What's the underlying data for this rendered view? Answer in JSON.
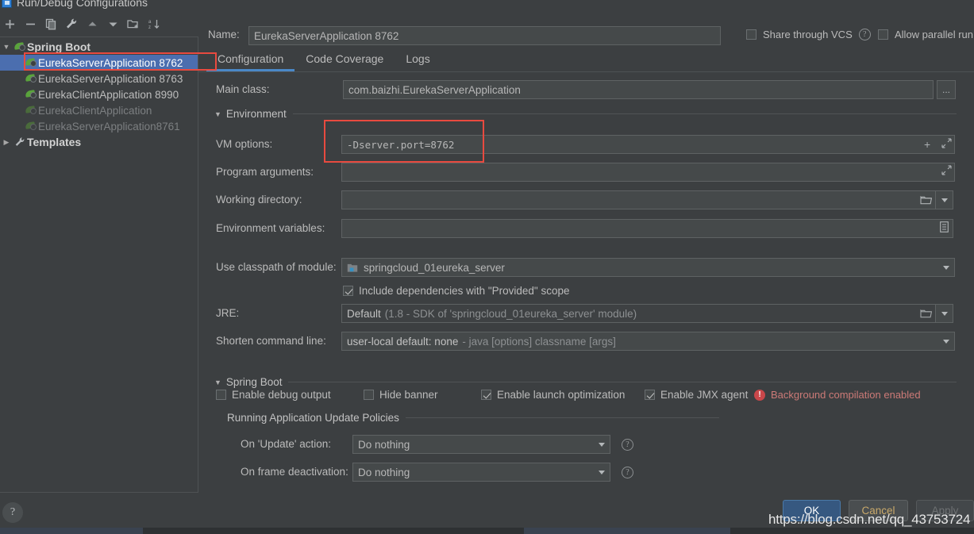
{
  "window": {
    "title": "Run/Debug Configurations",
    "icon": "idea-app-icon"
  },
  "toolbar": {
    "items": [
      {
        "name": "add-button",
        "icon": "plus-icon",
        "tooltip": "Add New Configuration"
      },
      {
        "name": "remove-button",
        "icon": "minus-icon",
        "tooltip": "Remove Configuration"
      },
      {
        "name": "copy-button",
        "icon": "copy-icon",
        "tooltip": "Copy Configuration"
      },
      {
        "name": "edit-templates-button",
        "icon": "wrench-icon",
        "tooltip": "Edit Templates"
      },
      {
        "name": "move-up-button",
        "icon": "arrow-up-icon",
        "tooltip": "Move Up"
      },
      {
        "name": "move-down-button",
        "icon": "arrow-down-icon",
        "tooltip": "Move Down"
      },
      {
        "name": "new-folder-button",
        "icon": "folder-add-icon",
        "tooltip": "Create New Folder"
      },
      {
        "name": "sort-button",
        "icon": "sort-alpha-icon",
        "tooltip": "Sort Configurations"
      }
    ]
  },
  "tree": {
    "group_label": "Spring Boot",
    "group_icon": "spring-boot-icon",
    "items": [
      {
        "label": "EurekaServerApplication 8762",
        "icon": "spring-boot-icon",
        "selected": true,
        "dim": false
      },
      {
        "label": "EurekaServerApplication 8763",
        "icon": "spring-boot-icon",
        "selected": false,
        "dim": false
      },
      {
        "label": "EurekaClientApplication 8990",
        "icon": "spring-boot-icon",
        "selected": false,
        "dim": false
      },
      {
        "label": "EurekaClientApplication",
        "icon": "spring-boot-icon",
        "selected": false,
        "dim": true
      },
      {
        "label": "EurekaServerApplication8761",
        "icon": "spring-boot-icon",
        "selected": false,
        "dim": true
      }
    ],
    "templates_label": "Templates",
    "templates_icon": "wrench-icon"
  },
  "header": {
    "name_label": "Name:",
    "name_value": "EurekaServerApplication 8762",
    "share_vcs_label": "Share through VCS",
    "share_vcs_checked": false,
    "share_vcs_help_icon": "help-icon",
    "allow_parallel_label": "Allow parallel run",
    "allow_parallel_checked": false
  },
  "tabs": [
    {
      "label": "Configuration",
      "active": true
    },
    {
      "label": "Code Coverage",
      "active": false
    },
    {
      "label": "Logs",
      "active": false
    }
  ],
  "form": {
    "main_class_label": "Main class:",
    "main_class_value": "com.baizhi.EurekaServerApplication",
    "main_class_browse_icon": "ellipsis-icon",
    "environment_group": "Environment",
    "vm_options_label": "VM options:",
    "vm_options_value": "-Dserver.port=8762",
    "vm_options_add_icon": "plus-icon",
    "vm_options_expand_icon": "expand-icon",
    "program_args_label": "Program arguments:",
    "program_args_value": "",
    "program_args_expand_icon": "expand-icon",
    "working_dir_label": "Working directory:",
    "working_dir_value": "",
    "working_dir_browse_icon": "folder-icon",
    "working_dir_dropdown_icon": "chevron-down-icon",
    "env_vars_label": "Environment variables:",
    "env_vars_value": "",
    "env_vars_browse_icon": "list-icon",
    "classpath_label": "Use classpath of module:",
    "classpath_value": "springcloud_01eureka_server",
    "classpath_icon": "module-icon",
    "classpath_dropdown_icon": "chevron-down-icon",
    "include_provided_label": "Include dependencies with \"Provided\" scope",
    "include_provided_checked": true,
    "jre_label": "JRE:",
    "jre_value_strong": "Default",
    "jre_value_dim": "(1.8 - SDK of 'springcloud_01eureka_server' module)",
    "jre_browse_icon": "folder-icon",
    "jre_dropdown_icon": "chevron-down-icon",
    "shorten_cmd_label": "Shorten command line:",
    "shorten_cmd_strong": "user-local default: none",
    "shorten_cmd_dim": "- java [options] classname [args]",
    "shorten_cmd_dropdown_icon": "chevron-down-icon"
  },
  "springboot": {
    "group_label": "Spring Boot",
    "checkboxes": [
      {
        "label": "Enable debug output",
        "checked": false
      },
      {
        "label": "Hide banner",
        "checked": false
      },
      {
        "label": "Enable launch optimization",
        "checked": true
      },
      {
        "label": "Enable JMX agent",
        "checked": true
      }
    ],
    "warning_icon": "error-circle-icon",
    "warning_text": "Background compilation enabled",
    "policies_group": "Running Application Update Policies",
    "on_update_label": "On 'Update' action:",
    "on_update_value": "Do nothing",
    "on_update_help_icon": "help-icon",
    "on_deactivation_label": "On frame deactivation:",
    "on_deactivation_value": "Do nothing",
    "on_deactivation_help_icon": "help-icon",
    "dropdown_icon": "chevron-down-icon"
  },
  "footer": {
    "help_label": "?",
    "ok_label": "OK",
    "cancel_label": "Cancel",
    "apply_label": "Apply",
    "apply_disabled": true
  },
  "watermark": "https://blog.csdn.net/qq_43753724",
  "colors": {
    "background": "#3c3f41",
    "field_background": "#45494a",
    "selection_blue": "#4b6eaf",
    "tab_accent": "#4a88c7",
    "primary_button": "#365880",
    "annotation_red": "#e84a3f",
    "error_red": "#c9474a",
    "spring_green": "#5aa33c"
  }
}
